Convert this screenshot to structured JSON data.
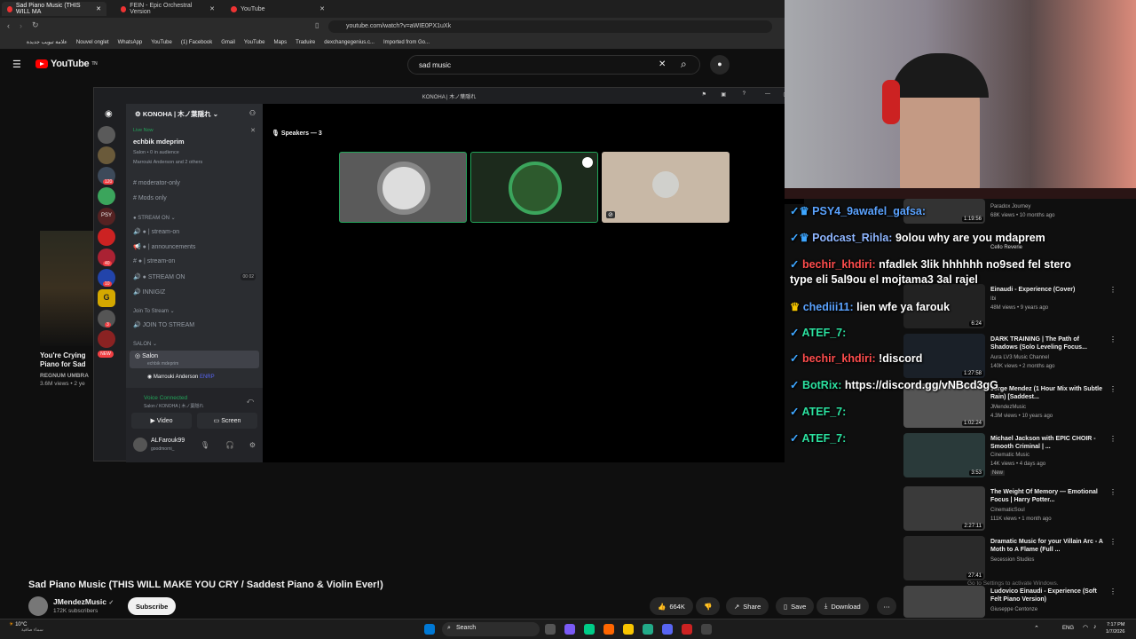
{
  "browser": {
    "tabs": [
      {
        "label": "Sad Piano Music (THIS WILL MA"
      },
      {
        "label": "FEIN - Epic Orchestral Version"
      },
      {
        "label": "YouTube"
      }
    ],
    "url": "youtube.com/watch?v=aWIE0PX1uXk",
    "bookmarks": [
      "علامة تبويب جديدة",
      "Nouvel onglet",
      "WhatsApp",
      "YouTube",
      "(1) Facebook",
      "Gmail",
      "YouTube",
      "Maps",
      "Traduire",
      "dexchangegenius.c...",
      "Imported from Go..."
    ]
  },
  "youtube": {
    "logo": "YouTube",
    "logo_sup": "TN",
    "search_value": "sad music",
    "video_title": "Sad Piano Music (THIS WILL MAKE YOU CRY / Saddest Piano & Violin Ever!)",
    "channel_name": "JMendezMusic",
    "subscribers": "172K subscribers",
    "subscribe_label": "Subscribe",
    "like_count": "664K",
    "share_label": "Share",
    "save_label": "Save",
    "download_label": "Download",
    "left_peek": {
      "title1": "You're Crying",
      "title2": "Piano for Sad",
      "channel": "REGNUM UMBRA",
      "views": "3.6M views • 2 ye"
    }
  },
  "discord": {
    "window_title": "KONOHA | 木ノ葉隠れ",
    "server_name": "KONOHA | 木ノ葉隠れ",
    "live_now": "Live Now",
    "live_channel": "echbik mdeprim",
    "live_meta": "Salon • 0 in audience",
    "live_people": "Marrouki Anderson and 2 others",
    "channels": {
      "moderator": "moderator-only",
      "mods": "Mods only",
      "stream_cat": "STREAM ON",
      "stream_on_1": "| stream-on",
      "announcements": "| announcements",
      "stream_on_2": "| stream-on",
      "stream_on_voice": "STREAM ON",
      "stream_on_voice_count": "00",
      "stream_on_voice_count2": "02",
      "innigiz": "INNIGIZ",
      "join_cat": "Join To Stream",
      "join_channel": "JOIN TO STREAM",
      "salon_cat": "SALON",
      "salon": "Salon",
      "salon_sub": "echbik mdeprim",
      "salon_member": "Marrouki Anderson",
      "salon_member_tag": "ENRP"
    },
    "voice_connected": "Voice Connected",
    "voice_location": "Salon / KONOHA | 木ノ葉隠れ",
    "video_btn": "Video",
    "screen_btn": "Screen",
    "username": "ALFarouk99",
    "user_status": "goodmorni_",
    "speakers_label": "Speakers — 3",
    "server_badges": [
      "120",
      "PSY",
      "40",
      "10",
      "G",
      "3",
      "NEW"
    ]
  },
  "chat": [
    {
      "user": "PSY4_9awafel_gafsa:",
      "msg": "",
      "color": "#5ba3ff"
    },
    {
      "user": "Podcast_Rihla:",
      "msg": "9olou why are you mdaprem",
      "color": "#8fb6ff"
    },
    {
      "user": "bechir_khdiri:",
      "msg": "nfadlek 3lik hhhhhh no9sed fel stero",
      "msg2": "type eli 5al9ou el mojtama3 3al rajel",
      "color": "#ff4d4d"
    },
    {
      "user": "chediii11:",
      "msg": "lien wfe ya farouk",
      "color": "#5ba3ff"
    },
    {
      "user": "ATEF_7:",
      "msg": "",
      "color": "#2ce2a0"
    },
    {
      "user": "bechir_khdiri:",
      "msg": "!discord",
      "color": "#ff4d4d"
    },
    {
      "user": "BotRix:",
      "msg": "https://discord.gg/vNBcd3gG",
      "color": "#2ce2a0"
    },
    {
      "user": "ATEF_7:",
      "msg": "",
      "color": "#2ce2a0"
    },
    {
      "user": "ATEF_7:",
      "msg": "",
      "color": "#2ce2a0"
    }
  ],
  "sidebar": [
    {
      "title": "",
      "meta1": "Paradox Journey",
      "meta2": "68K views • 10 months ago",
      "duration": "1:19:56"
    },
    {
      "title": "",
      "meta1": "Cello Reverie",
      "meta2": "",
      "duration": ""
    },
    {
      "title": "Einaudi - Experience (Cover)",
      "meta1": "Ibi",
      "meta2": "48M views • 9 years ago",
      "duration": "6:24"
    },
    {
      "title": "DARK TRAINING | The Path of Shadows (Solo Leveling Focus...",
      "meta1": "Aura LV3 Music Channel",
      "meta2": "140K views • 2 months ago",
      "duration": "1:27:58"
    },
    {
      "title": "Jorge Mendez (1 Hour Mix with Subtle Rain) [Saddest...",
      "meta1": "JMendezMusic",
      "meta2": "4.3M views • 10 years ago",
      "duration": "1:02:24"
    },
    {
      "title": "Michael Jackson with EPIC CHOIR - Smooth Criminal | ...",
      "meta1": "Cinematic Music",
      "meta2": "14K views • 4 days ago",
      "badge": "New",
      "duration": "3:53"
    },
    {
      "title": "The Weight Of Memory — Emotional Focus | Harry Potter...",
      "meta1": "CinematicSoul",
      "meta2": "111K views • 1 month ago",
      "duration": "2:27:11"
    },
    {
      "title": "Dramatic Music for your Villain Arc - A Moth to A Flame (Full ...",
      "meta1": "Secession Studios",
      "meta2": "",
      "duration": "27:41"
    },
    {
      "title": "Ludovico Einaudi - Experience (Soft Felt Piano Version)",
      "meta1": "Giuseppe Centonze",
      "meta2": "",
      "duration": ""
    }
  ],
  "activate_windows": "Go to Settings to activate Windows.",
  "taskbar": {
    "weather_temp": "10°C",
    "weather_text": "سماء صافية",
    "search_label": "Search",
    "lang": "ENG",
    "time": "7:17 PM",
    "date": "1/7/2026"
  }
}
